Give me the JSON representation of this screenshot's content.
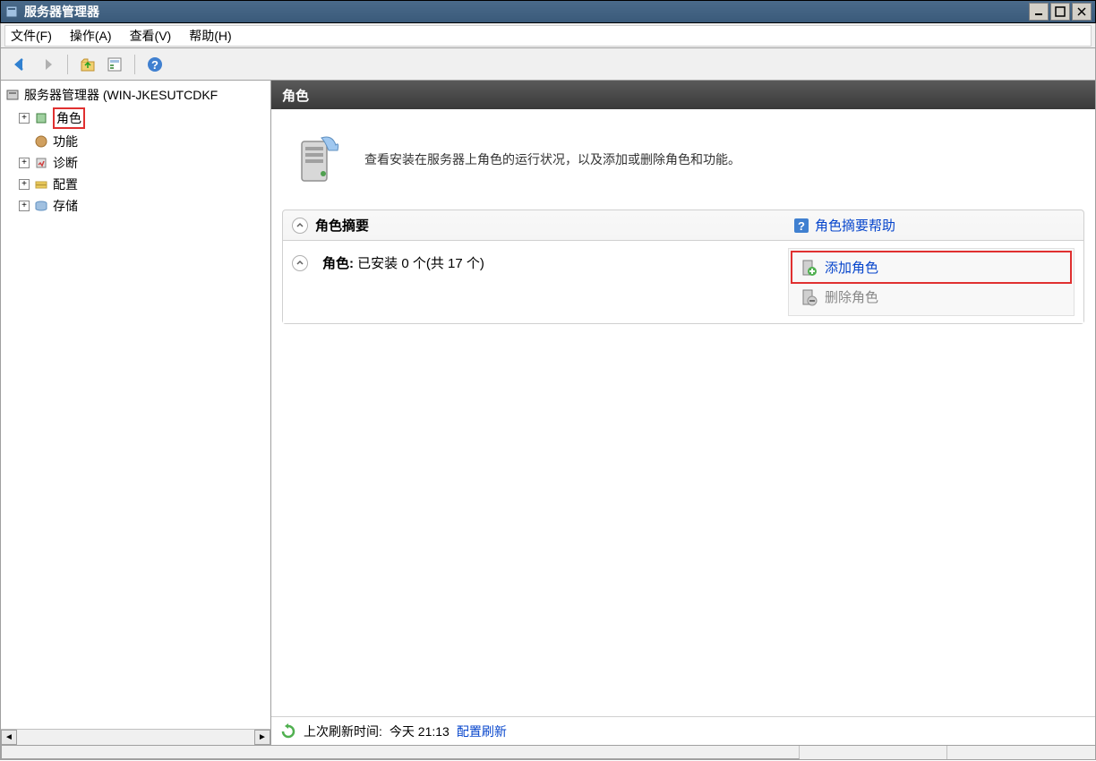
{
  "titlebar": {
    "title": "服务器管理器"
  },
  "menubar": {
    "file": "文件(F)",
    "action": "操作(A)",
    "view": "查看(V)",
    "help": "帮助(H)"
  },
  "tree": {
    "root": "服务器管理器 (WIN-JKESUTCDKF",
    "roles": "角色",
    "features": "功能",
    "diagnostics": "诊断",
    "configuration": "配置",
    "storage": "存储"
  },
  "content": {
    "header": "角色",
    "info_text": "查看安装在服务器上角色的运行状况，以及添加或删除角色和功能。",
    "summary_title": "角色摘要",
    "summary_help": "角色摘要帮助",
    "roles_label": "角色:",
    "roles_count": "已安装 0 个(共 17 个)",
    "add_role": "添加角色",
    "remove_role": "删除角色",
    "footer_label": "上次刷新时间:",
    "footer_time": "今天 21:13",
    "footer_link": "配置刷新"
  }
}
